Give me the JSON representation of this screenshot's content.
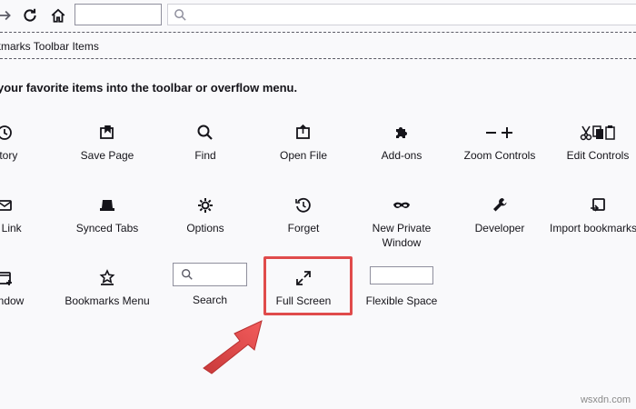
{
  "instruction": "your favorite items into the toolbar or overflow menu.",
  "bookmarks_toolbar": {
    "label": "kmarks Toolbar Items"
  },
  "items": [
    {
      "label": "istory",
      "icon": "clock-icon"
    },
    {
      "label": "Save Page",
      "icon": "save-page-icon"
    },
    {
      "label": "Find",
      "icon": "search-icon"
    },
    {
      "label": "Open File",
      "icon": "open-file-icon"
    },
    {
      "label": "Add-ons",
      "icon": "puzzle-icon"
    },
    {
      "label": "Zoom Controls",
      "icon": "zoom-controls-icon"
    },
    {
      "label": "Edit Controls",
      "icon": "edit-controls-icon"
    },
    {
      "label": "ail Link",
      "icon": "mail-icon"
    },
    {
      "label": "Synced Tabs",
      "icon": "synced-tabs-icon"
    },
    {
      "label": "Options",
      "icon": "gear-icon"
    },
    {
      "label": "Forget",
      "icon": "forget-icon"
    },
    {
      "label": "New Private Window",
      "icon": "mask-icon"
    },
    {
      "label": "Developer",
      "icon": "wrench-icon"
    },
    {
      "label": "Import bookmarks...",
      "icon": "import-icon"
    },
    {
      "label": "Window",
      "icon": "new-window-icon"
    },
    {
      "label": "Bookmarks Menu",
      "icon": "bookmark-star-icon"
    },
    {
      "label": "Search",
      "icon": "search-field"
    },
    {
      "label": "Full Screen",
      "icon": "fullscreen-icon"
    },
    {
      "label": "Flexible Space",
      "icon": "flexible-space"
    }
  ],
  "highlight_color": "#e04b4b",
  "watermark": "wsxdn.com"
}
